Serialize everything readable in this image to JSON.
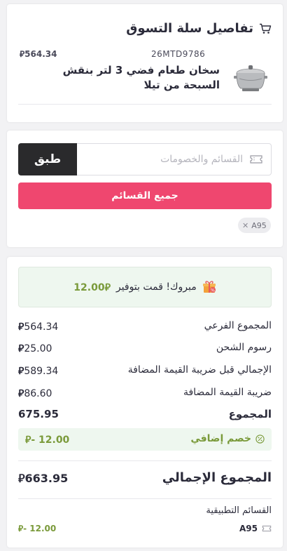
{
  "cart": {
    "title": "تفاصيل سلة التسوق",
    "item": {
      "sku": "26MTD9786",
      "price": "564.34",
      "currency": "⃁",
      "name": "سخان طعام فضي 3 لتر بنقش السبحة من تيلا"
    }
  },
  "voucher": {
    "placeholder": "القسائم والخصومات",
    "apply_label": "طبق",
    "all_vouchers_label": "جميع القسائم",
    "chip_code": "A95"
  },
  "summary": {
    "congrats_text": "مبروك! قمت بتوفير",
    "congrats_amount": "12.00",
    "rows": [
      {
        "label": "المجموع الفرعي",
        "value": "564.34"
      },
      {
        "label": "رسوم الشحن",
        "value": "25.00"
      },
      {
        "label": "الإجمالي قبل ضريبة القيمة المضافة",
        "value": "589.34"
      },
      {
        "label": "ضريبة القيمة المضافة",
        "value": "86.60"
      }
    ],
    "total_label": "المجموع",
    "total_value": "675.95",
    "discount_label": "خصم إضافي",
    "discount_value": "- 12.00",
    "grand_label": "المجموع الإجمالي",
    "grand_value": "663.95",
    "applied_title": "القسائم التطبيقية",
    "applied_code": "A95",
    "applied_amount": "- 12.00"
  },
  "colors": {
    "accent": "#ef476f",
    "dark_button": "#2a2a2c",
    "success_bg": "#eef7ef",
    "success_text": "#7a9a3a"
  }
}
